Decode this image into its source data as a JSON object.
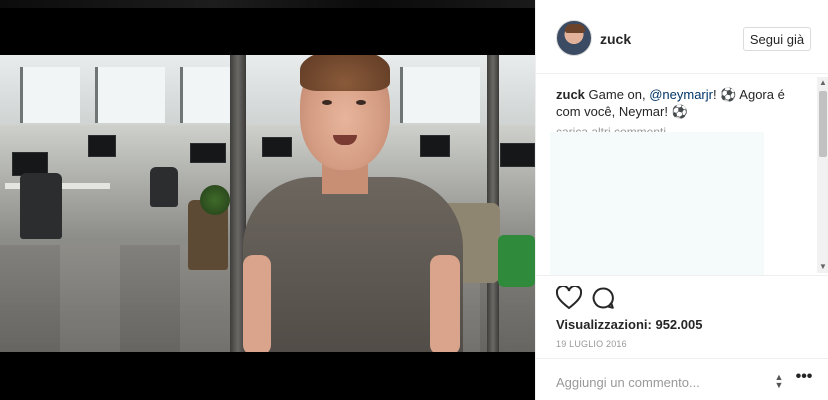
{
  "post": {
    "username": "zuck",
    "follow_label": "Segui già",
    "caption": {
      "author": "zuck",
      "text_before": " Game on, ",
      "mention": "@neymarjr",
      "text_after": "! ⚽ Agora é com você, Neymar! ⚽"
    },
    "load_more_label": "carica altri commenti",
    "views_label": "Visualizzazioni:",
    "views_count": "952.005",
    "date": "19 LUGLIO 2016",
    "comment_placeholder": "Aggiungi un commento...",
    "more_label": "•••"
  },
  "icons": {
    "like": "heart-icon",
    "comment": "comment-bubble-icon",
    "avatar": "avatar-image",
    "more": "more-options-icon"
  },
  "colors": {
    "text": "#262626",
    "muted": "#999999",
    "mention": "#003569",
    "border": "#efefef"
  }
}
